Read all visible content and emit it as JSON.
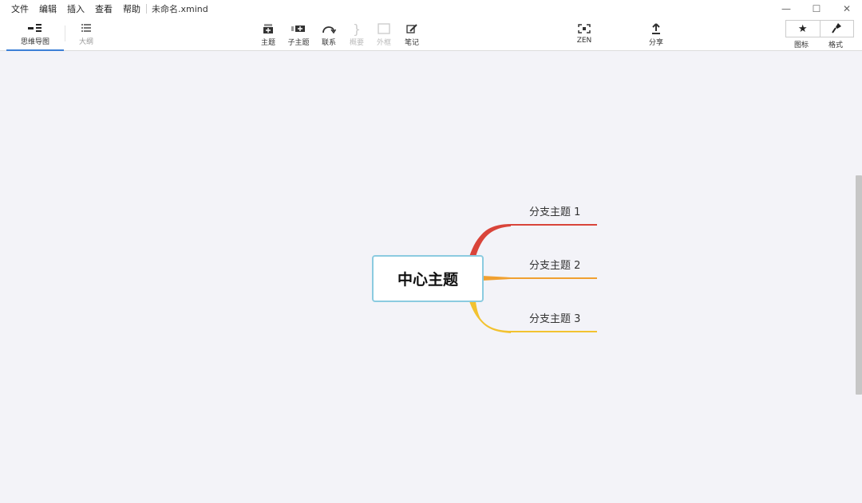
{
  "menu": [
    "文件",
    "编辑",
    "插入",
    "查看",
    "帮助"
  ],
  "document_title": "未命名.xmind",
  "window_controls": {
    "minimize": "—",
    "maximize": "☐",
    "close": "✕"
  },
  "view_tabs": [
    {
      "label": "思维导图",
      "active": true,
      "icon": "mindmap-icon"
    },
    {
      "label": "大纲",
      "active": false,
      "icon": "outline-icon"
    }
  ],
  "tools": [
    {
      "label": "主题",
      "icon": "topic-icon",
      "enabled": true
    },
    {
      "label": "子主题",
      "icon": "subtopic-icon",
      "enabled": true
    },
    {
      "label": "联系",
      "icon": "relationship-icon",
      "enabled": true
    },
    {
      "label": "概要",
      "icon": "summary-icon",
      "enabled": false
    },
    {
      "label": "外框",
      "icon": "boundary-icon",
      "enabled": false
    },
    {
      "label": "笔记",
      "icon": "notes-icon",
      "enabled": true
    }
  ],
  "zen": {
    "label": "ZEN",
    "icon": "zen-icon"
  },
  "share": {
    "label": "分享",
    "icon": "share-icon"
  },
  "right_panel": [
    {
      "label": "图标",
      "icon": "star-icon"
    },
    {
      "label": "格式",
      "icon": "brush-icon"
    }
  ],
  "mindmap": {
    "central_topic": "中心主题",
    "branches": [
      {
        "label": "分支主题 1",
        "color": "#d9443a"
      },
      {
        "label": "分支主题 2",
        "color": "#f0a030"
      },
      {
        "label": "分支主题 3",
        "color": "#f2c230"
      }
    ]
  },
  "colors": {
    "accent": "#3b7fd6",
    "central_border": "#8bcbe0"
  }
}
